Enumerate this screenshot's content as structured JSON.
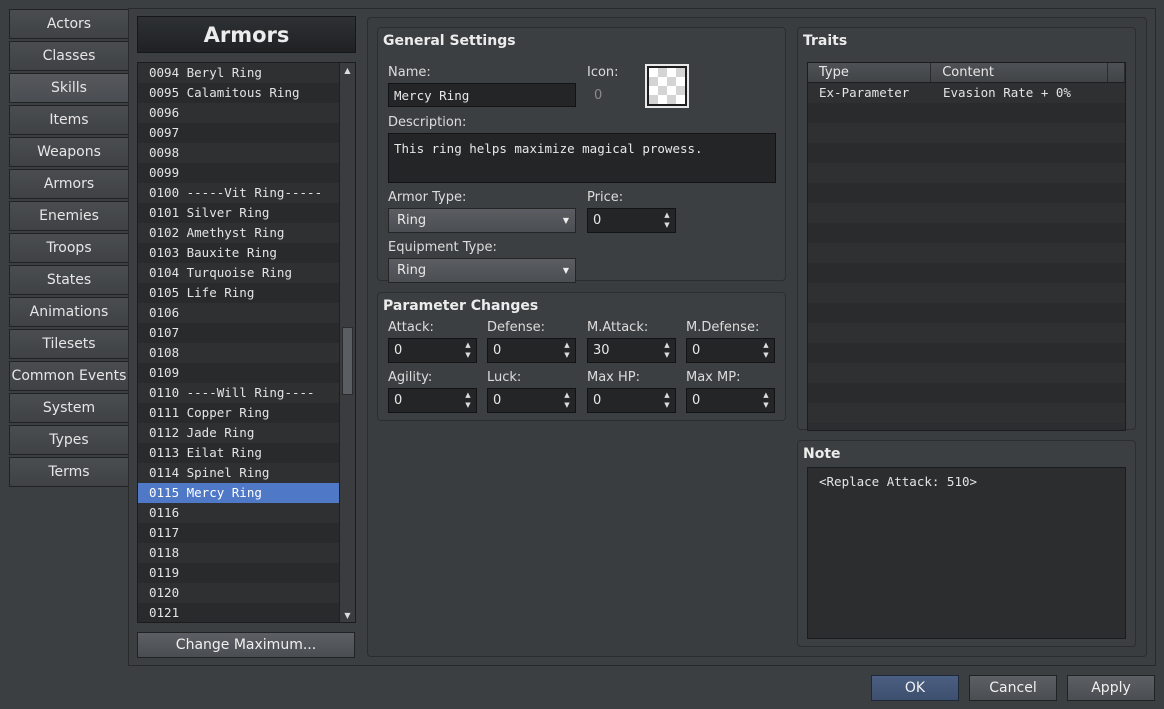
{
  "nav": {
    "items": [
      "Actors",
      "Classes",
      "Skills",
      "Items",
      "Weapons",
      "Armors",
      "Enemies",
      "Troops",
      "States",
      "Animations",
      "Tilesets",
      "Common Events",
      "System",
      "Types",
      "Terms"
    ],
    "active_index": 2
  },
  "list": {
    "title": "Armors",
    "rows": [
      "0094 Beryl Ring",
      "0095 Calamitous Ring",
      "0096",
      "0097",
      "0098",
      "0099",
      "0100 -----Vit Ring-----",
      "0101 Silver Ring",
      "0102 Amethyst Ring",
      "0103 Bauxite Ring",
      "0104 Turquoise Ring",
      "0105 Life Ring",
      "0106",
      "0107",
      "0108",
      "0109",
      "0110 ----Will Ring----",
      "0111 Copper Ring",
      "0112 Jade Ring",
      "0113 Eilat Ring",
      "0114 Spinel Ring",
      "0115 Mercy Ring",
      "0116",
      "0117",
      "0118",
      "0119",
      "0120",
      "0121"
    ],
    "selected_index": 21,
    "change_max_label": "Change Maximum..."
  },
  "general": {
    "title": "General Settings",
    "name_label": "Name:",
    "name_value": "Mercy Ring",
    "icon_label": "Icon:",
    "icon_index": "0",
    "description_label": "Description:",
    "description_value": "This ring helps maximize magical prowess.",
    "armor_type_label": "Armor Type:",
    "armor_type_value": "Ring",
    "price_label": "Price:",
    "price_value": "0",
    "equip_type_label": "Equipment Type:",
    "equip_type_value": "Ring"
  },
  "params": {
    "title": "Parameter Changes",
    "fields": [
      {
        "label": "Attack:",
        "value": "0"
      },
      {
        "label": "Defense:",
        "value": "0"
      },
      {
        "label": "M.Attack:",
        "value": "30"
      },
      {
        "label": "M.Defense:",
        "value": "0"
      },
      {
        "label": "Agility:",
        "value": "0"
      },
      {
        "label": "Luck:",
        "value": "0"
      },
      {
        "label": "Max HP:",
        "value": "0"
      },
      {
        "label": "Max MP:",
        "value": "0"
      }
    ]
  },
  "traits": {
    "title": "Traits",
    "col_type": "Type",
    "col_content": "Content",
    "rows": [
      {
        "type": "Ex-Parameter",
        "content": "Evasion Rate + 0%"
      }
    ]
  },
  "note": {
    "title": "Note",
    "value": "<Replace Attack: 510>"
  },
  "buttons": {
    "ok": "OK",
    "cancel": "Cancel",
    "apply": "Apply"
  }
}
